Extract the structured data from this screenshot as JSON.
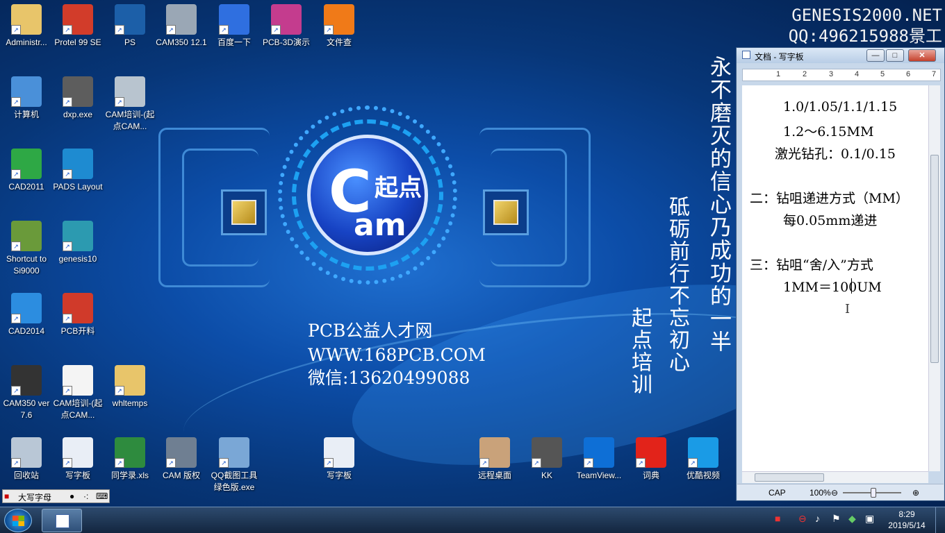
{
  "desktop_icons": [
    {
      "label": "Administr...",
      "icon": "user-folder-icon",
      "color": "#e8c56a"
    },
    {
      "label": "Protel 99 SE",
      "icon": "protel-icon",
      "color": "#d23c2a"
    },
    {
      "label": "PS",
      "icon": "photoshop-icon",
      "color": "#1c5fa8"
    },
    {
      "label": "CAM350 12.1",
      "icon": "cam350-icon",
      "color": "#9aa7b5"
    },
    {
      "label": "百度一下",
      "icon": "baidu-icon",
      "color": "#2f6fe0"
    },
    {
      "label": "PCB-3D演示",
      "icon": "pcb3d-icon",
      "color": "#c43c8e"
    },
    {
      "label": "文件查",
      "icon": "file-search-icon",
      "color": "#f07a18"
    },
    {
      "label": "计算机",
      "icon": "computer-icon",
      "color": "#4a90d9"
    },
    {
      "label": "dxp.exe",
      "icon": "dxp-icon",
      "color": "#5d5d5d"
    },
    {
      "label": "CAM培训-(起点CAM...",
      "icon": "video-file-icon",
      "color": "#b8c4cf"
    },
    {
      "label": "CAD2011",
      "icon": "cad2011-icon",
      "color": "#2ea845"
    },
    {
      "label": "PADS Layout",
      "icon": "pads-icon",
      "color": "#1e8bd1"
    },
    {
      "label": "Shortcut to Si9000",
      "icon": "si9000-icon",
      "color": "#6a9a3a"
    },
    {
      "label": "genesis10",
      "icon": "genesis-icon",
      "color": "#2c9ab0"
    },
    {
      "label": "CAD2014",
      "icon": "cad2014-icon",
      "color": "#2c8de0"
    },
    {
      "label": "PCB开料",
      "icon": "pcb-cut-icon",
      "color": "#d03a2a"
    },
    {
      "label": "CAM350 ver 7.6",
      "icon": "cam350-old-icon",
      "color": "#333333"
    },
    {
      "label": "CAM培训-(起点CAM...",
      "icon": "blank-file-icon",
      "color": "#f4f4f4"
    },
    {
      "label": "whltemps",
      "icon": "folder-icon",
      "color": "#e8c56a"
    },
    {
      "label": "回收站",
      "icon": "recycle-bin-icon",
      "color": "#b9c7d6"
    },
    {
      "label": "写字板",
      "icon": "wordpad-icon",
      "color": "#e9eef6"
    },
    {
      "label": "同学录.xls",
      "icon": "excel-file-icon",
      "color": "#2e8b3e"
    },
    {
      "label": "CAM 版权",
      "icon": "cam-copyright-icon",
      "color": "#6f7f92"
    },
    {
      "label": "QQ截图工具绿色版.exe",
      "icon": "screenshot-tool-icon",
      "color": "#7aa7d6"
    },
    {
      "label": "写字板",
      "icon": "wordpad-icon",
      "color": "#e9eef6"
    },
    {
      "label": "远程桌面",
      "icon": "remote-desktop-icon",
      "color": "#c9a27a"
    },
    {
      "label": "KK",
      "icon": "kk-icon",
      "color": "#555555"
    },
    {
      "label": "TeamView...",
      "icon": "teamviewer-icon",
      "color": "#0e6fd6"
    },
    {
      "label": "词典",
      "icon": "youdao-dict-icon",
      "color": "#e2231a"
    },
    {
      "label": "优酷视频",
      "icon": "youku-icon",
      "color": "#1a9be6"
    }
  ],
  "logo": {
    "line1": "C",
    "line2": "起点",
    "line3": "am"
  },
  "center_info": {
    "line1": "PCB公益人才网",
    "line2": "WWW.168PCB.COM",
    "line3": "微信:13620499088"
  },
  "vertical_texts": {
    "col1": "永不磨灭的信心乃成功的一半",
    "col2": "砥砺前行不忘初心",
    "col3": "起点培训"
  },
  "watermark": {
    "line1": "GENESIS2000.NET",
    "line2": "QQ:496215988景工"
  },
  "wordpad": {
    "title": "文档 - 写字板",
    "min_label": "—",
    "max_label": "□",
    "close_label": "✕",
    "ruler": [
      "1",
      "2",
      "3",
      "4",
      "5",
      "6",
      "7"
    ],
    "lines": [
      "1.0/1.05/1.1/1.15",
      "1.2～6.15MM",
      "激光钻孔：0.1/0.15",
      "二：钻咀递进方式（MM）",
      "每0.05mm递进",
      "三：钻咀“舍/入”方式",
      "1MM＝100UM"
    ],
    "status": {
      "caps": "CAP",
      "zoom": "100%"
    }
  },
  "ime": {
    "mode": "大写字母",
    "dot": "●",
    "punct": "·:",
    "keyboard": "⌨"
  },
  "taskbar": {
    "tray_icons": [
      "ime-tray-icon",
      "stop-icon",
      "volume-icon",
      "flag-icon",
      "shield-icon",
      "network-icon"
    ],
    "time": "8:29",
    "date": "2019/5/14"
  }
}
